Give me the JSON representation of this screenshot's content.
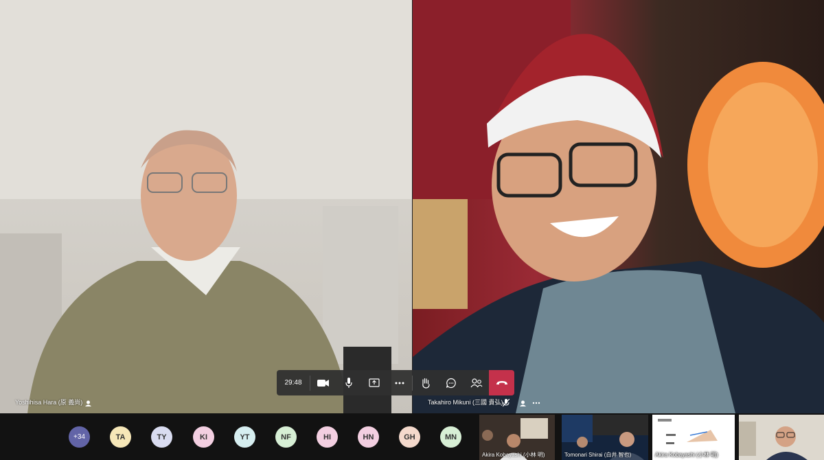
{
  "main_tiles": [
    {
      "name": "Yoshihisa Hara (原 義尚)"
    },
    {
      "name": "Takahiro Mikuni (三國 貴弘)"
    }
  ],
  "controls": {
    "timer": "29:48"
  },
  "participants": {
    "overflow_count": "+34",
    "avatars": [
      {
        "initials": "TA",
        "color": "#f6e7b8"
      },
      {
        "initials": "TY",
        "color": "#d9dcf0"
      },
      {
        "initials": "KI",
        "color": "#f3cfe1"
      },
      {
        "initials": "YT",
        "color": "#d6eef0"
      },
      {
        "initials": "NF",
        "color": "#d7efd5"
      },
      {
        "initials": "HI",
        "color": "#f3cfe1"
      },
      {
        "initials": "HN",
        "color": "#f3cfe1"
      },
      {
        "initials": "GH",
        "color": "#f4d9cc"
      },
      {
        "initials": "MN",
        "color": "#d7efd5"
      }
    ]
  },
  "thumbnails": [
    {
      "name": "Akira Kobayashi (小林 明)"
    },
    {
      "name": "Tomonari Shirai (白井 智也)"
    },
    {
      "name": "Akira Kobayashi (小林 明)"
    },
    {
      "name": ""
    }
  ],
  "colors": {
    "accent": "#6264a7",
    "hangup": "#c4314b",
    "bar": "#303030"
  }
}
